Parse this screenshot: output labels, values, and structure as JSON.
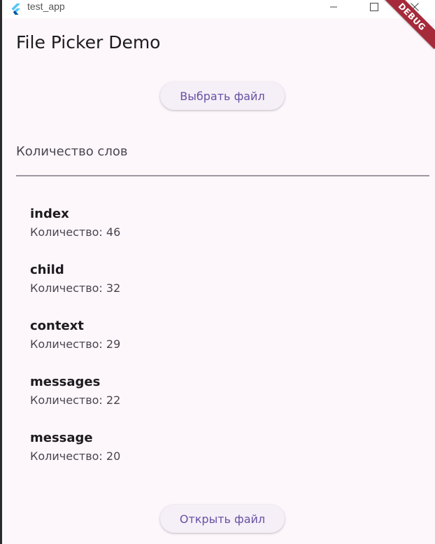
{
  "window": {
    "title": "test_app",
    "controls": {
      "minimize_icon": "minimize-icon",
      "maximize_icon": "maximize-icon",
      "close_icon": "close-icon"
    }
  },
  "debug_banner": "DEBUG",
  "app": {
    "title": "File Picker Demo",
    "pick_button": "Выбрать файл",
    "open_button": "Открыть файл",
    "input_label": "Количество слов"
  },
  "words": [
    {
      "word": "index",
      "count": "Количество: 46"
    },
    {
      "word": "child",
      "count": "Количество: 32"
    },
    {
      "word": "context",
      "count": "Количество: 29"
    },
    {
      "word": "messages",
      "count": "Количество: 22"
    },
    {
      "word": "message",
      "count": "Количество: 20"
    }
  ],
  "colors": {
    "accent": "#6750a4",
    "background": "#fdf7fc",
    "debug_banner": "#a52a3a"
  }
}
